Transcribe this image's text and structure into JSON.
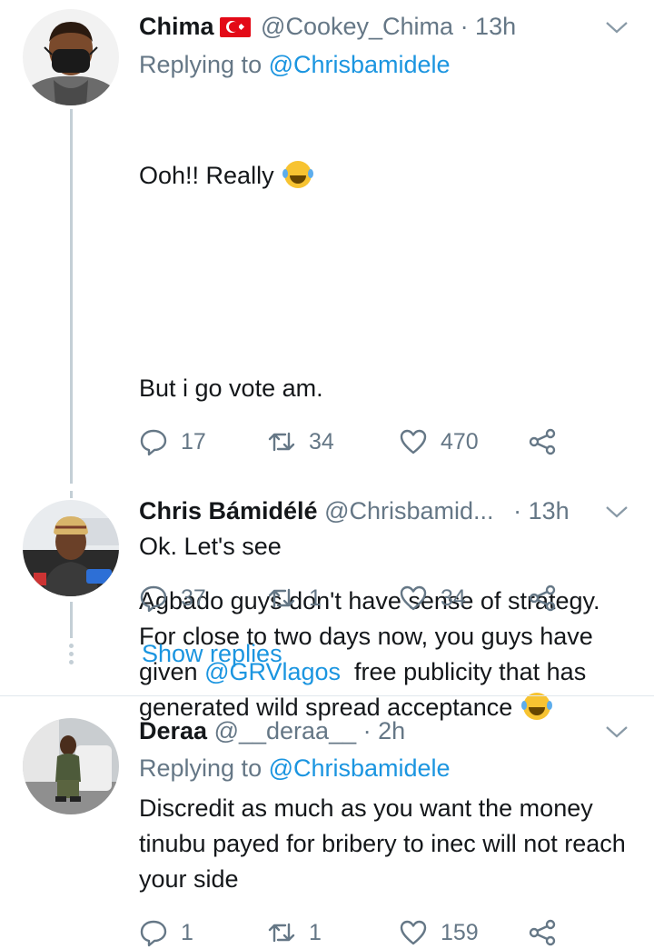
{
  "tweets": [
    {
      "name": "Chima",
      "handle": "@Cookey_Chima",
      "time": "· 13h",
      "replying_prefix": "Replying to ",
      "replying_to": "@Chrisbamidele",
      "text_1": "Ooh!! Really",
      "text_2": "But i go vote am.",
      "text_3a": "Agbado guys don't have sense of strategy. For close to two days now, you guys have given ",
      "mention": "@GRVlagos",
      "text_3b": "  free publicity that has generated wild spread acceptance",
      "replies": "17",
      "retweets": "34",
      "likes": "470"
    },
    {
      "name": "Chris Bámidélé",
      "handle": "@Chrisbamid...",
      "time": "· 13h",
      "text": "Ok. Let's see",
      "replies": "37",
      "retweets": "1",
      "likes": "34"
    },
    {
      "name": "Deraa",
      "handle": "@__deraa__",
      "time": "· 2h",
      "replying_prefix": "Replying to ",
      "replying_to": "@Chrisbamidele",
      "text": "Discredit as much as you want the money tinubu payed for bribery to inec will not reach your side",
      "replies": "1",
      "retweets": "1",
      "likes": "159"
    }
  ],
  "show_replies": "Show replies",
  "colors": {
    "link": "#1b95e0",
    "muted": "#657786",
    "thread_line": "#c4cfd6"
  }
}
